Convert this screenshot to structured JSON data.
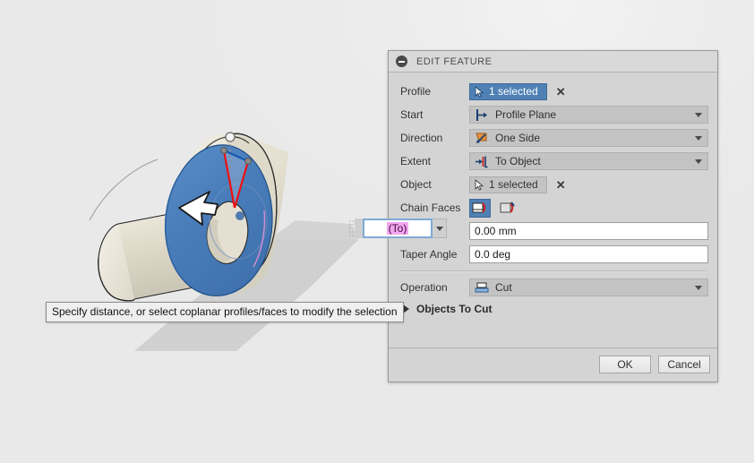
{
  "dialog": {
    "title": "EDIT FEATURE",
    "collapse_icon": "collapse-minus-icon",
    "rows": {
      "profile": {
        "label": "Profile",
        "value": "1 selected",
        "icon": "cursor-select-icon",
        "clear": "✕"
      },
      "start": {
        "label": "Start",
        "value": "Profile Plane",
        "icon": "profile-plane-icon"
      },
      "direction": {
        "label": "Direction",
        "value": "One Side",
        "icon": "one-side-arrow-icon"
      },
      "extent": {
        "label": "Extent",
        "value": "To Object",
        "icon": "to-object-icon"
      },
      "object": {
        "label": "Object",
        "value": "1 selected",
        "icon": "cursor-select-icon",
        "clear": "✕"
      },
      "chain_faces": {
        "label": "Chain Faces",
        "option_on_icon": "chain-faces-on-icon",
        "option_off_icon": "chain-faces-off-icon"
      },
      "distance": {
        "value": "0.00 mm"
      },
      "taper_angle": {
        "label": "Taper Angle",
        "value": "0.0 deg"
      },
      "operation": {
        "label": "Operation",
        "value": "Cut",
        "icon": "cut-operation-icon"
      },
      "objects_to_cut": {
        "label": "Objects To Cut",
        "expander_icon": "triangle-right-icon"
      }
    },
    "footer": {
      "ok_label": "OK",
      "cancel_label": "Cancel"
    }
  },
  "float_input": {
    "value": "(To)",
    "dropdown_icon": "chevron-down-icon",
    "drag_handle_icon": "drag-dots-icon"
  },
  "tooltip": {
    "text": "Specify distance, or select coplanar profiles/faces to modify the selection"
  },
  "viewport": {
    "cursor_icon": "arrow-cursor-icon",
    "model_description": "cylinder-with-highlighted-annular-face"
  },
  "colors": {
    "accent_blue": "#4f81b5",
    "panel_gray": "#d4d4d4",
    "field_gray": "#c3c3c3",
    "highlight_face": "#4a7ebb",
    "sketch_red": "#ee1111",
    "selection_pink": "#f3a6ef"
  }
}
